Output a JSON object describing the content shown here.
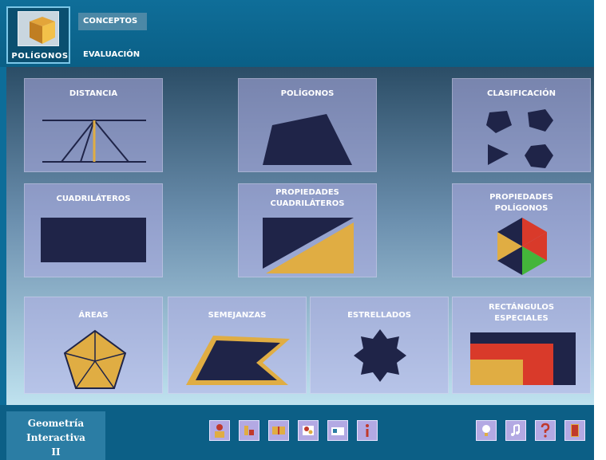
{
  "header": {
    "logo_label": "POLÍGONOS",
    "menu": {
      "conceptos": "CONCEPTOS",
      "evaluacion": "EVALUACIÓN"
    }
  },
  "tiles": {
    "distancia": "DISTANCIA",
    "poligonos": "POLÍGONOS",
    "clasificacion": "CLASIFICACIÓN",
    "cuadrilateros": "CUADRILÁTEROS",
    "propiedades_cuadrilateros": [
      "PROPIEDADES",
      "CUADRILÁTEROS"
    ],
    "propiedades_poligonos": [
      "PROPIEDADES",
      "POLÍGONOS"
    ],
    "areas": "ÁREAS",
    "semejanzas": "SEMEJANZAS",
    "estrellados": "ESTRELLADOS",
    "rectangulos_especiales": [
      "RECTÁNGULOS",
      "ESPECIALES"
    ]
  },
  "footer": {
    "app_title": [
      "Geometría",
      "Interactiva",
      "II"
    ],
    "toolbar_left": [
      "person-icon",
      "blocks-icon",
      "book-icon",
      "puzzle-icon",
      "id-card-icon",
      "info-icon"
    ],
    "toolbar_right": [
      "lightbulb-icon",
      "music-icon",
      "help-icon",
      "exit-door-icon"
    ]
  },
  "colors": {
    "shape_dark": "#1f2448",
    "shape_gold": "#e0ad43",
    "tile_bg": "#b4afe6",
    "accent_blue": "#0d6d99"
  }
}
